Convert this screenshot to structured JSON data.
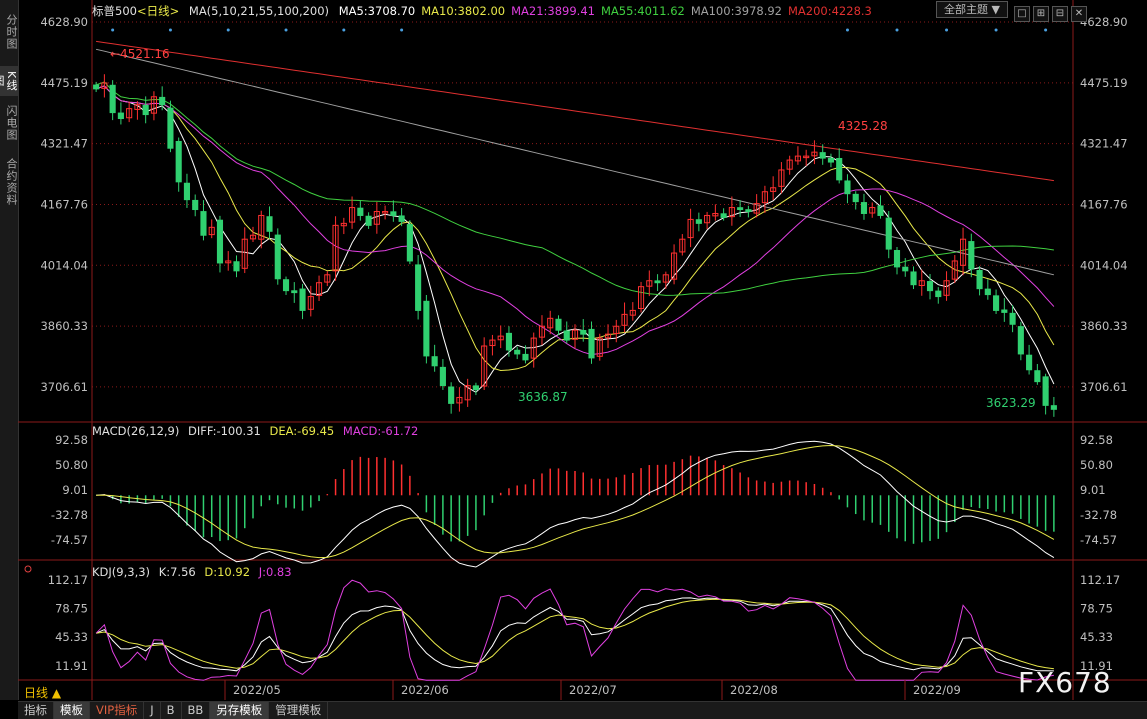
{
  "sidebar": {
    "tabs": [
      "分时图",
      "K线图",
      "闪电图",
      "合约资料"
    ],
    "active_index": 1
  },
  "header": {
    "symbol": "标普500",
    "period_tag": "<日线>",
    "ma_params": "MA(5,10,21,55,100,200)",
    "ma_values": [
      {
        "label": "MA5:3708.70",
        "color": "#ffffff"
      },
      {
        "label": "MA10:3802.00",
        "color": "#e8e84a"
      },
      {
        "label": "MA21:3899.41",
        "color": "#e040e0"
      },
      {
        "label": "MA55:4011.62",
        "color": "#40d040"
      },
      {
        "label": "MA100:3978.92",
        "color": "#a0a0a0"
      },
      {
        "label": "MA200:4228.3",
        "color": "#e03030"
      }
    ],
    "theme_button": "全部主题",
    "theme_arrow": "▼",
    "window_buttons": [
      "□",
      "⊞",
      "⊟",
      "✕"
    ]
  },
  "price_axis": {
    "ticks": [
      "4628.90",
      "4475.19",
      "4321.47",
      "4167.76",
      "4014.04",
      "3860.33",
      "3706.61"
    ]
  },
  "annotations": {
    "high1": "4521.16",
    "low1": "3636.87",
    "high2": "4325.28",
    "low2": "3623.29"
  },
  "macd": {
    "title": "MACD(26,12,9)",
    "diff": "DIFF:-100.31",
    "dea": "DEA:-69.45",
    "macd": "MACD:-61.72",
    "ticks": [
      "92.58",
      "50.80",
      "9.01",
      "-32.78",
      "-74.57"
    ]
  },
  "kdj": {
    "title": "KDJ(9,3,3)",
    "k": "K:7.56",
    "d": "D:10.92",
    "j": "J:0.83",
    "ticks": [
      "112.17",
      "78.75",
      "45.33",
      "11.91"
    ]
  },
  "dates": [
    "2022/05",
    "2022/06",
    "2022/07",
    "2022/08",
    "2022/09"
  ],
  "period_button": "日线 ▲",
  "bottom_tabs": [
    {
      "label": "指标",
      "active": false,
      "vip": false
    },
    {
      "label": "模板",
      "active": true,
      "vip": false
    },
    {
      "label": "VIP指标",
      "active": false,
      "vip": true
    },
    {
      "label": "J",
      "active": false,
      "vip": false
    },
    {
      "label": "B",
      "active": false,
      "vip": false
    },
    {
      "label": "BB",
      "active": false,
      "vip": false
    },
    {
      "label": "另存模板",
      "active": true,
      "vip": false
    },
    {
      "label": "管理模板",
      "active": false,
      "vip": false
    }
  ],
  "watermark": "FX678",
  "colors": {
    "up": "#ff3030",
    "down": "#30d070",
    "grid": "#8b1a1a",
    "axis_text": "#c0c0c0"
  },
  "chart_data": {
    "type": "candlestick",
    "title": "标普500 <日线>",
    "x_range": [
      "2022-04-21",
      "2022-09-16"
    ],
    "y_range": [
      3623,
      4629
    ],
    "close": [
      4460,
      4475,
      4400,
      4385,
      4410,
      4420,
      4395,
      4440,
      4420,
      4310,
      4225,
      4180,
      4155,
      4090,
      4110,
      4020,
      4025,
      4000,
      4080,
      4090,
      4140,
      4100,
      3980,
      3950,
      3945,
      3900,
      3935,
      3970,
      3990,
      4115,
      4120,
      4160,
      4140,
      4115,
      4150,
      4150,
      4140,
      4125,
      4025,
      3900,
      3785,
      3760,
      3710,
      3665,
      3680,
      3710,
      3700,
      3810,
      3825,
      3835,
      3800,
      3790,
      3775,
      3830,
      3860,
      3880,
      3850,
      3825,
      3850,
      3840,
      3780,
      3830,
      3840,
      3860,
      3890,
      3900,
      3960,
      3975,
      3970,
      3990,
      4045,
      4080,
      4130,
      4120,
      4140,
      4145,
      4135,
      4160,
      4155,
      4150,
      4170,
      4200,
      4210,
      4255,
      4280,
      4290,
      4290,
      4300,
      4285,
      4275,
      4230,
      4195,
      4175,
      4145,
      4160,
      4140,
      4055,
      4010,
      4000,
      3965,
      3975,
      3950,
      3935,
      3975,
      4025,
      4080,
      4005,
      3955,
      3940,
      3900,
      3895,
      3865,
      3790,
      3750,
      3720,
      3660,
      3650
    ]
  }
}
